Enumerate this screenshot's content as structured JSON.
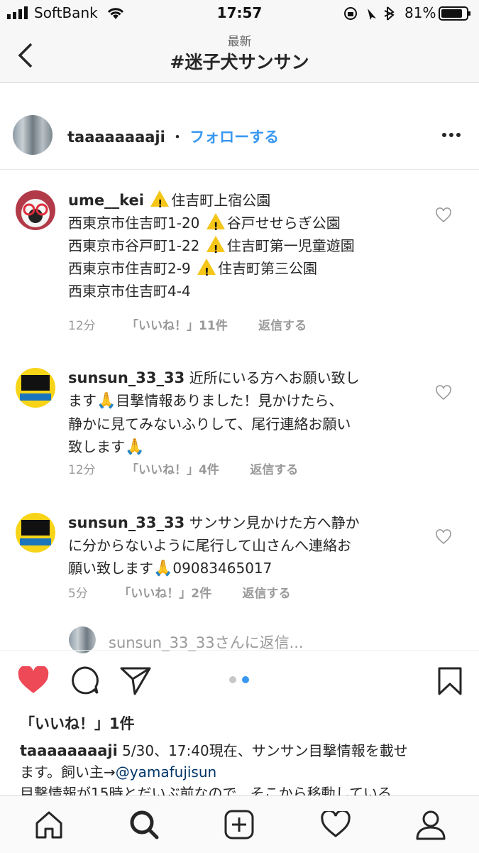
{
  "status_bar": {
    "carrier": "SoftBank",
    "time": "17:57",
    "battery": "81%"
  },
  "nav": {
    "subtitle": "最新",
    "title": "#迷子犬サンサン"
  },
  "post": {
    "username": "taaaaaaaaji",
    "separator": "・",
    "follow_label": "フォローする"
  },
  "comments": [
    {
      "username": "ume__kei",
      "text_parts": [
        "住吉町上宿公園",
        "西東京市住吉町1-20",
        "谷戸せせらぎ公園",
        "西東京市谷戸町1-22",
        "住吉町第一児童遊園",
        "西東京市住吉町2-9",
        "住吉町第三公園",
        "西東京市住吉町4-4"
      ],
      "time": "12分",
      "likes": "「いいね！」11件",
      "reply": "返信する"
    },
    {
      "username": "sunsun_33_33",
      "text_a": "近所にいる方へお願い致し",
      "text_b": "ます",
      "text_c": "目撃情報ありました！見かけたら、",
      "text_d": "静かに見てみないふりして、尾行連絡お願い",
      "text_e": "致します",
      "time": "12分",
      "likes": "「いいね！」4件",
      "reply": "返信する"
    },
    {
      "username": "sunsun_33_33",
      "text_a": "サンサン見かけた方へ静か",
      "text_b": "に分からないように尾行して山さんへ連絡お",
      "text_c": "願い致します",
      "text_d": "09083465017",
      "time": "5分",
      "likes": "「いいね！」2件",
      "reply": "返信する"
    }
  ],
  "reply_prompt": "sunsun_33_33さんに返信...",
  "likes_count": "「いいね！」1件",
  "caption": {
    "username": "taaaaaaaaji",
    "text_a": "5/30、17:40現在、サンサン目撃情報を載せ",
    "text_b": "ます。飼い主→",
    "mention": "@yamafujisun",
    "text_c": "目撃情報が15時とだいぶ前なので、そこから移動している"
  },
  "colors": {
    "link_blue": "#3897f0",
    "like_red": "#ed4956",
    "warning_yellow": "#f5c518"
  }
}
